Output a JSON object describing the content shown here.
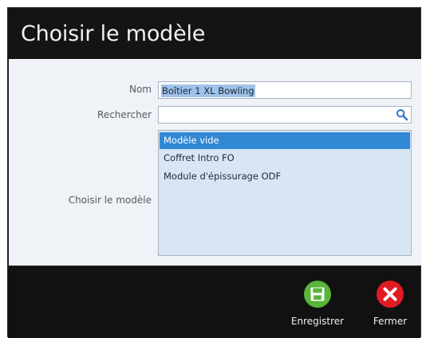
{
  "dialog": {
    "title": "Choisir le modèle"
  },
  "form": {
    "name": {
      "label": "Nom",
      "value": "Boîtier 1 XL Bowling"
    },
    "search": {
      "label": "Rechercher",
      "value": "",
      "icon": "search-icon"
    },
    "template": {
      "label": "Choisir le modèle",
      "options": [
        "Modèle vide",
        "Coffret Intro FO",
        "Module d'épissurage ODF"
      ],
      "selected_index": 0
    }
  },
  "footer": {
    "save_label": "Enregistrer",
    "save_icon": "floppy-disk-icon",
    "close_label": "Fermer",
    "close_icon": "close-icon"
  },
  "colors": {
    "dialog_bg": "#141414",
    "form_bg": "#eff2f7",
    "accent": "#3188d4",
    "save": "#59b43a",
    "close": "#e01b24"
  }
}
